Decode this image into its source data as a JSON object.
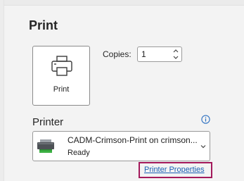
{
  "page": {
    "heading": "Print"
  },
  "print_button": {
    "label": "Print",
    "icon": "printer-icon"
  },
  "copies": {
    "label": "Copies:",
    "value": "1"
  },
  "printer": {
    "heading": "Printer",
    "selected_name": "CADM-Crimson-Print on crimson...",
    "status": "Ready",
    "icon": "printer-device-icon",
    "info_icon": "info-icon"
  },
  "printer_properties": {
    "label": "Printer Properties",
    "highlight_color": "#a3195b"
  },
  "colors": {
    "background": "#f3f3f3",
    "link": "#1a5fb4",
    "accent_info": "#2b6fc0"
  }
}
